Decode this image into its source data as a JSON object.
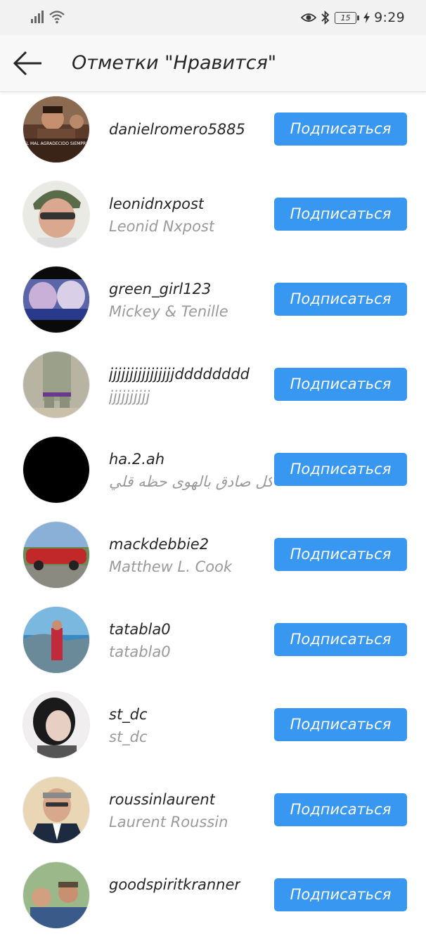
{
  "status_bar": {
    "time": "9:29",
    "battery": "15",
    "icons": [
      "signal-icon",
      "wifi-icon",
      "eye-icon",
      "bluetooth-icon",
      "battery-icon",
      "charging-icon"
    ]
  },
  "header": {
    "title": "Отметки \"Нравится\"",
    "back_icon": "arrow-left-icon"
  },
  "colors": {
    "accent": "#3897f0",
    "username": "#262626",
    "fullname": "#9a9a9a"
  },
  "users": [
    {
      "username": "danielromero5885",
      "fullname": "",
      "button": "Подписаться",
      "avatar_text": "EL MAL AGRADECIDO SIEMPRE"
    },
    {
      "username": "leonidnxpost",
      "fullname": "Leonid Nxpost",
      "button": "Подписаться"
    },
    {
      "username": "green_girl123",
      "fullname": "Mickey & Tenille",
      "button": "Подписаться"
    },
    {
      "username": "jjjjjjjjjjjjjjjjdddddddd",
      "fullname": "jjjjjjjjjj",
      "button": "Подписаться"
    },
    {
      "username": "ha.2.ah",
      "fullname": "كل صادق بالهوى حظه قلي..",
      "button": "Подписаться"
    },
    {
      "username": "mackdebbie2",
      "fullname": "Matthew L. Cook",
      "button": "Подписаться"
    },
    {
      "username": "tatabla0",
      "fullname": "tatabla0",
      "button": "Подписаться"
    },
    {
      "username": "st_dc",
      "fullname": "st_dc",
      "button": "Подписаться"
    },
    {
      "username": "roussinlaurent",
      "fullname": "Laurent Roussin",
      "button": "Подписаться"
    },
    {
      "username": "goodspiritkranner",
      "fullname": "",
      "button": "Подписаться"
    }
  ]
}
